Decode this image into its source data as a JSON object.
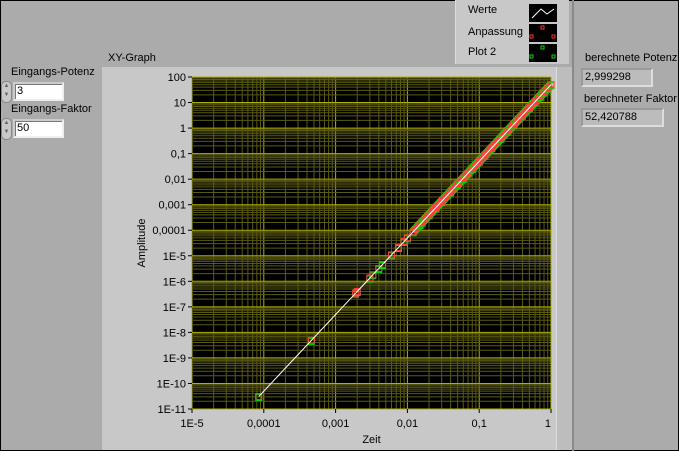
{
  "controls": {
    "power": {
      "label": "Eingangs-Potenz",
      "value": "3"
    },
    "factor": {
      "label": "Eingangs-Faktor",
      "value": "50"
    }
  },
  "indicators": {
    "power": {
      "label": "berechnete Potenz",
      "value": "2,999298"
    },
    "factor": {
      "label": "berechneter Faktor",
      "value": "52,420788"
    }
  },
  "legend": [
    {
      "name": "Werte",
      "color": "#ffffff",
      "style": "line"
    },
    {
      "name": "Anpassung",
      "color": "#ff3333",
      "style": "square-marker"
    },
    {
      "name": "Plot 2",
      "color": "#00dd00",
      "style": "square-marker"
    }
  ],
  "chart_data": {
    "type": "scatter",
    "title": "XY-Graph",
    "xlabel": "Zeit",
    "ylabel": "Amplitude",
    "xscale": "log",
    "yscale": "log",
    "xlim": [
      1e-05,
      1
    ],
    "ylim": [
      1e-11,
      100
    ],
    "xticks": [
      "1E-5",
      "0,0001",
      "0,001",
      "0,01",
      "0,1",
      "1"
    ],
    "yticks": [
      "1E-11",
      "1E-10",
      "1E-9",
      "1E-8",
      "1E-7",
      "1E-6",
      "1E-5",
      "0,0001",
      "0,001",
      "0,01",
      "0,1",
      "1",
      "10",
      "100"
    ],
    "grid": true,
    "grid_color": "#b0b000",
    "background": "#000000",
    "points": [
      [
        8.5e-05,
        3.07e-11
      ],
      [
        0.00046,
        4.87e-09
      ],
      [
        0.0019,
        3.43e-07
      ],
      [
        0.002,
        4e-07
      ],
      [
        0.003,
        1.35e-06
      ],
      [
        0.0033,
        1.8e-06
      ],
      [
        0.004,
        3.2e-06
      ],
      [
        0.0045,
        4.56e-06
      ],
      [
        0.006,
        1.08e-05
      ],
      [
        0.0075,
        2.11e-05
      ],
      [
        0.009,
        3.65e-05
      ],
      [
        0.01,
        5e-05
      ],
      [
        0.012,
        8.64e-05
      ],
      [
        0.015,
        0.000169
      ],
      [
        0.016,
        0.000205
      ],
      [
        0.02,
        0.0004
      ],
      [
        0.025,
        0.000781
      ],
      [
        0.03,
        0.00135
      ],
      [
        0.04,
        0.0032
      ],
      [
        0.05,
        0.00625
      ],
      [
        0.06,
        0.0108
      ],
      [
        0.07,
        0.0172
      ],
      [
        0.08,
        0.0256
      ],
      [
        0.1,
        0.05
      ],
      [
        0.12,
        0.0864
      ],
      [
        0.15,
        0.169
      ],
      [
        0.2,
        0.4
      ],
      [
        0.25,
        0.781
      ],
      [
        0.3,
        1.35
      ],
      [
        0.4,
        3.2
      ],
      [
        0.5,
        6.25
      ],
      [
        0.6,
        10.8
      ],
      [
        0.7,
        17.15
      ],
      [
        0.8,
        25.6
      ],
      [
        0.9,
        36.45
      ],
      [
        1,
        50
      ]
    ]
  }
}
